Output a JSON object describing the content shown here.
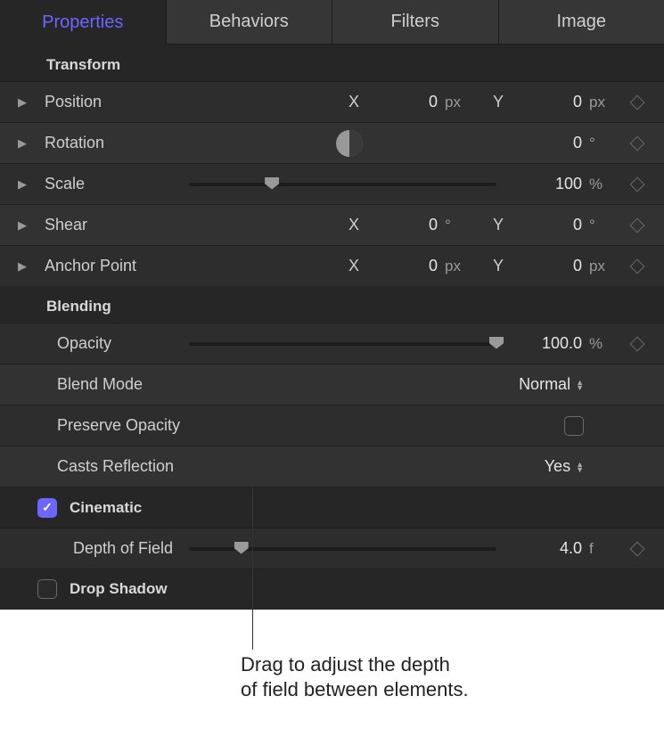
{
  "tabs": {
    "properties": "Properties",
    "behaviors": "Behaviors",
    "filters": "Filters",
    "image": "Image"
  },
  "sections": {
    "transform": "Transform",
    "blending": "Blending"
  },
  "transform": {
    "position": {
      "label": "Position",
      "x_label": "X",
      "x_value": "0",
      "x_unit": "px",
      "y_label": "Y",
      "y_value": "0",
      "y_unit": "px"
    },
    "rotation": {
      "label": "Rotation",
      "value": "0",
      "unit": "°"
    },
    "scale": {
      "label": "Scale",
      "value": "100",
      "unit": "%",
      "slider_pct": 27
    },
    "shear": {
      "label": "Shear",
      "x_label": "X",
      "x_value": "0",
      "x_unit": "°",
      "y_label": "Y",
      "y_value": "0",
      "y_unit": "°"
    },
    "anchor": {
      "label": "Anchor Point",
      "x_label": "X",
      "x_value": "0",
      "x_unit": "px",
      "y_label": "Y",
      "y_value": "0",
      "y_unit": "px"
    }
  },
  "blending": {
    "opacity": {
      "label": "Opacity",
      "value": "100.0",
      "unit": "%",
      "slider_pct": 100
    },
    "blend_mode": {
      "label": "Blend Mode",
      "value": "Normal"
    },
    "preserve": {
      "label": "Preserve Opacity",
      "checked": false
    },
    "casts": {
      "label": "Casts Reflection",
      "value": "Yes"
    }
  },
  "cinematic": {
    "section": "Cinematic",
    "checked": true,
    "depth": {
      "label": "Depth of Field",
      "value": "4.0",
      "unit": "f",
      "slider_pct": 17
    }
  },
  "drop_shadow": {
    "label": "Drop Shadow",
    "checked": false
  },
  "callout": "Drag to adjust the depth\nof field between elements."
}
